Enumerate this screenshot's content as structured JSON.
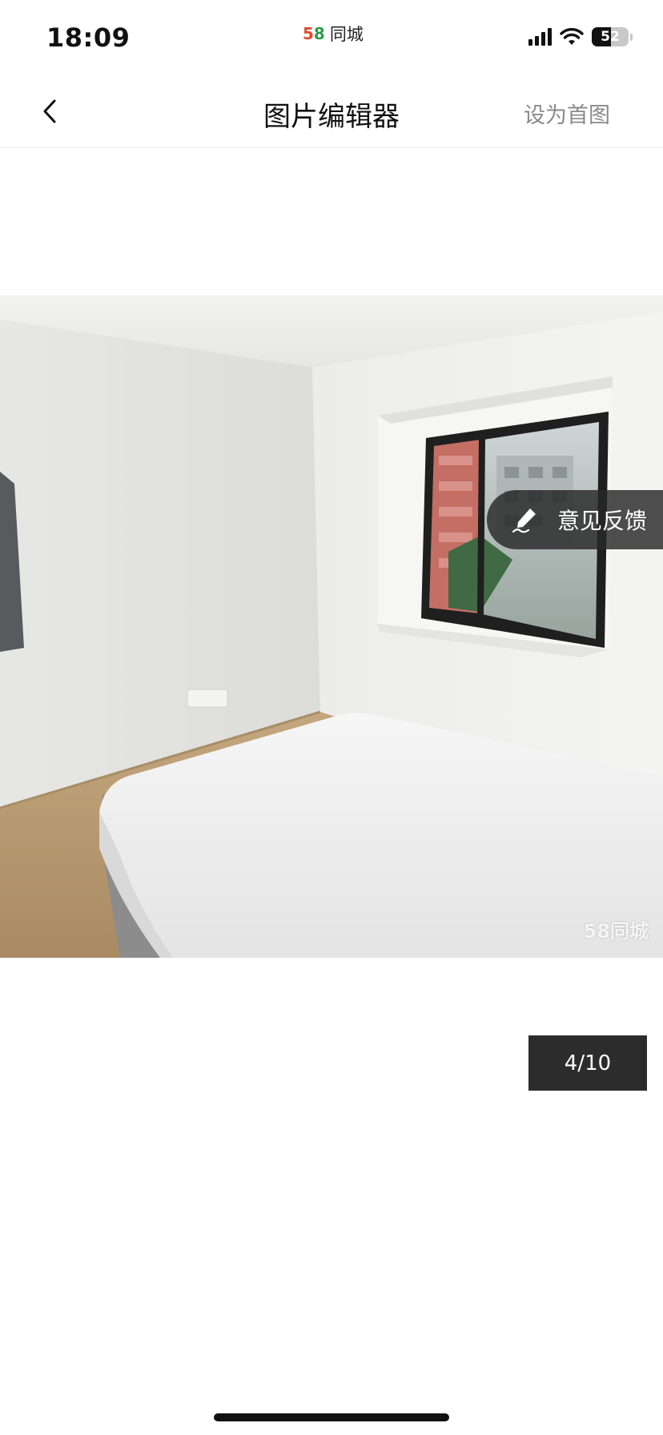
{
  "status_bar": {
    "time": "18:09",
    "app_logo": "58",
    "app_name": "同城",
    "battery": "52",
    "battery_level": 0.52,
    "icons": [
      "signal-icon",
      "wifi-icon",
      "battery-icon"
    ]
  },
  "nav": {
    "back_icon": "chevron-left-icon",
    "title": "图片编辑器",
    "set_cover_label": "设为首图"
  },
  "photo": {
    "watermark": "58同城"
  },
  "feedback": {
    "icon": "pen-edit-icon",
    "label": "意见反馈"
  },
  "pager": {
    "counter": "4/10"
  },
  "colors": {
    "feedback_bg": "#282828",
    "counter_bg": "#2c2c2c",
    "set_cover_text": "#8a8a8a"
  }
}
